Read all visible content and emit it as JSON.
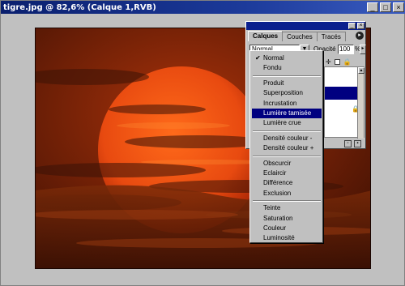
{
  "window": {
    "title": "tigre.jpg @ 82,6% (Calque  1,RVB)"
  },
  "palette": {
    "tabs": [
      "Calques",
      "Couches",
      "Tracés"
    ],
    "mode_value": "Normal",
    "opacity_label": "Opacité :",
    "opacity_value": "100",
    "opacity_unit": "%"
  },
  "menu": {
    "groups": [
      [
        "Normal",
        "Fondu"
      ],
      [
        "Produit",
        "Superposition",
        "Incrustation",
        "Lumière tamisée",
        "Lumière crue"
      ],
      [
        "Densité couleur -",
        "Densité couleur +"
      ],
      [
        "Obscurcir",
        "Eclaircir",
        "Différence",
        "Exclusion"
      ],
      [
        "Teinte",
        "Saturation",
        "Couleur",
        "Luminosité"
      ]
    ],
    "checked": "Normal",
    "highlighted": "Lumière tamisée"
  },
  "colors": {
    "titlebar": "#0a1f6e",
    "highlight": "#000080",
    "sun": "#e84a10",
    "sky": "#5a1a06"
  }
}
